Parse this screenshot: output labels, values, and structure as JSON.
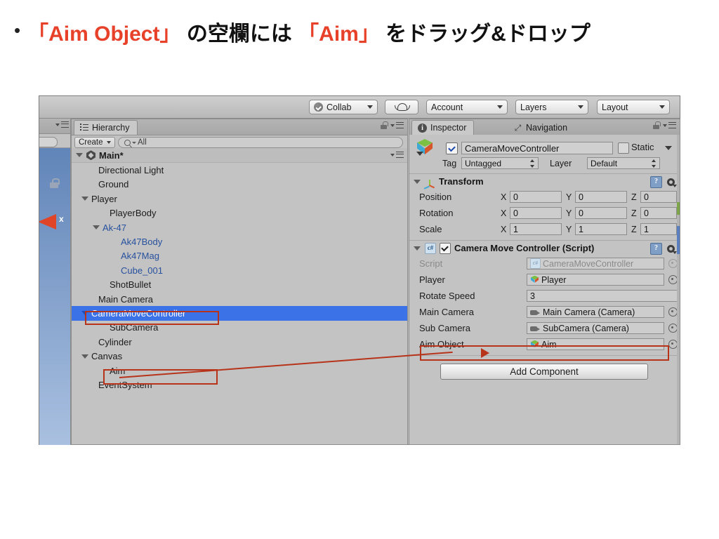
{
  "slide": {
    "bullet_marker": "•",
    "headline_parts": [
      {
        "text": "「Aim Object」",
        "color": "#e8412a"
      },
      {
        "text": " の空欄には ",
        "color": "#111111"
      },
      {
        "text": "「Aim」",
        "color": "#e8412a"
      },
      {
        "text": " をドラッグ&ドロップ",
        "color": "#111111"
      }
    ],
    "headline_full": "「Aim Object」 の空欄には 「Aim」 をドラッグ&ドロップ",
    "part_1": "「Aim Object」",
    "part_2": " の空欄には ",
    "part_3": "「Aim」",
    "part_4": " をドラッグ&ドロップ"
  },
  "toolbar": {
    "collab_label": "Collab",
    "cloud_icon": "cloud-icon",
    "account_label": "Account",
    "layers_label": "Layers",
    "layout_label": "Layout"
  },
  "hierarchy": {
    "tab_label": "Hierarchy",
    "tab_icon": "hierarchy-list-icon",
    "create_label": "Create",
    "search_value": "All",
    "search_icon": "search-icon",
    "lock_icon": "lock-icon",
    "menu_icon": "panel-menu-icon",
    "items": [
      {
        "label": "Main*",
        "depth": 0,
        "arrow": "down",
        "prefab": false,
        "selected": false,
        "root": true
      },
      {
        "label": "Directional Light",
        "depth": 1,
        "arrow": "none",
        "prefab": false,
        "selected": false
      },
      {
        "label": "Ground",
        "depth": 1,
        "arrow": "none",
        "prefab": false,
        "selected": false
      },
      {
        "label": "Player",
        "depth": 1,
        "arrow": "down",
        "prefab": false,
        "selected": false
      },
      {
        "label": "PlayerBody",
        "depth": 2,
        "arrow": "none",
        "prefab": false,
        "selected": false
      },
      {
        "label": "Ak-47",
        "depth": 2,
        "arrow": "down",
        "prefab": true,
        "selected": false
      },
      {
        "label": "Ak47Body",
        "depth": 3,
        "arrow": "none",
        "prefab": true,
        "selected": false
      },
      {
        "label": "Ak47Mag",
        "depth": 3,
        "arrow": "none",
        "prefab": true,
        "selected": false
      },
      {
        "label": "Cube_001",
        "depth": 3,
        "arrow": "none",
        "prefab": true,
        "selected": false
      },
      {
        "label": "ShotBullet",
        "depth": 2,
        "arrow": "none",
        "prefab": false,
        "selected": false
      },
      {
        "label": "Main Camera",
        "depth": 1,
        "arrow": "none",
        "prefab": false,
        "selected": false
      },
      {
        "label": "CameraMoveController",
        "depth": 1,
        "arrow": "down",
        "prefab": false,
        "selected": true
      },
      {
        "label": "SubCamera",
        "depth": 2,
        "arrow": "none",
        "prefab": false,
        "selected": false
      },
      {
        "label": "Cylinder",
        "depth": 1,
        "arrow": "none",
        "prefab": false,
        "selected": false
      },
      {
        "label": "Canvas",
        "depth": 1,
        "arrow": "down",
        "prefab": false,
        "selected": false
      },
      {
        "label": "Aim",
        "depth": 2,
        "arrow": "none",
        "prefab": false,
        "selected": false
      },
      {
        "label": "EventSystem",
        "depth": 1,
        "arrow": "none",
        "prefab": false,
        "selected": false
      }
    ]
  },
  "inspector": {
    "tab_label": "Inspector",
    "tab_icon": "info-icon",
    "nav_tab_label": "Navigation",
    "nav_tab_icon": "navigation-icon",
    "lock_icon": "lock-icon",
    "menu_icon": "panel-menu-icon",
    "gameobject": {
      "enabled": true,
      "name": "CameraMoveController",
      "static_label": "Static",
      "static_checked": false,
      "tag_label": "Tag",
      "tag_value": "Untagged",
      "layer_label": "Layer",
      "layer_value": "Default"
    },
    "transform": {
      "title": "Transform",
      "rows": [
        {
          "label": "Position",
          "x": "0",
          "y": "0",
          "z": "0"
        },
        {
          "label": "Rotation",
          "x": "0",
          "y": "0",
          "z": "0"
        },
        {
          "label": "Scale",
          "x": "1",
          "y": "1",
          "z": "1"
        }
      ],
      "axis_x": "X",
      "axis_y": "Y",
      "axis_z": "Z",
      "help_icon": "help-icon",
      "gear_icon": "gear-icon"
    },
    "script_component": {
      "title": "Camera Move Controller (Script)",
      "enabled": true,
      "help_icon": "help-icon",
      "gear_icon": "gear-icon",
      "properties": [
        {
          "label": "Script",
          "value": "CameraMoveController",
          "icon": "script-icon",
          "disabled": true,
          "type": "object"
        },
        {
          "label": "Player",
          "value": "Player",
          "icon": "cube-icon",
          "disabled": false,
          "type": "object"
        },
        {
          "label": "Rotate Speed",
          "value": "3",
          "icon": "none",
          "disabled": false,
          "type": "number"
        },
        {
          "label": "Main Camera",
          "value": "Main Camera (Camera)",
          "icon": "camera-icon",
          "disabled": false,
          "type": "object"
        },
        {
          "label": "Sub Camera",
          "value": "SubCamera (Camera)",
          "icon": "camera-icon",
          "disabled": false,
          "type": "object"
        },
        {
          "label": "Aim Object",
          "value": "Aim",
          "icon": "cube-icon",
          "disabled": false,
          "type": "object"
        }
      ]
    },
    "add_component_label": "Add Component"
  },
  "annotations": {
    "color": "#b7341b",
    "highlight_hierarchy_item": "CameraMoveController",
    "highlight_hierarchy_item_2": "Aim",
    "highlight_inspector_row": "Aim Object",
    "arrow_from": "Aim",
    "arrow_to": "Aim Object"
  },
  "scene_view": {
    "lock_icon": "lock-icon",
    "gizmo_axis_label": "x"
  }
}
